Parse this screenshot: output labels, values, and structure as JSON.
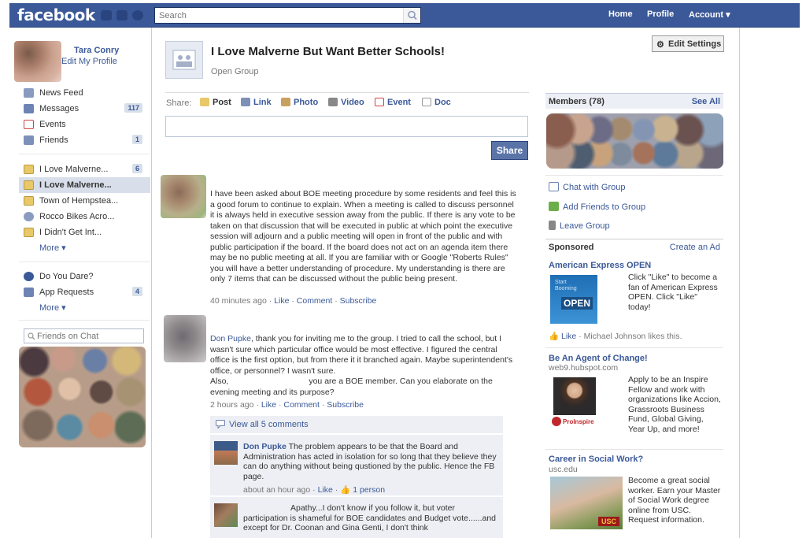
{
  "topbar": {
    "logo": "facebook",
    "search_placeholder": "Search",
    "nav": [
      "Home",
      "Profile",
      "Account"
    ]
  },
  "sidebar": {
    "profile_name": "Tara Conry",
    "edit_profile": "Edit My Profile",
    "items": [
      {
        "label": "News Feed",
        "icon": "news-feed-icon"
      },
      {
        "label": "Messages",
        "count": "117",
        "icon": "messages-icon"
      },
      {
        "label": "Events",
        "icon": "events-icon"
      },
      {
        "label": "Friends",
        "count": "1",
        "icon": "friends-icon"
      }
    ],
    "groups": [
      {
        "label": "I Love Malverne...",
        "count": "6"
      },
      {
        "label": "I Love Malverne..."
      },
      {
        "label": "Town of Hempstea..."
      },
      {
        "label": "Rocco Bikes Acro..."
      },
      {
        "label": "I Didn't Get Int..."
      }
    ],
    "more_label": "More",
    "apps": [
      {
        "label": "Do You Dare?"
      },
      {
        "label": "App Requests",
        "count": "4"
      }
    ],
    "chat_placeholder": "Friends on Chat"
  },
  "group": {
    "title": "I Love Malverne But Want Better Schools!",
    "type": "Open Group",
    "edit_settings": "Edit Settings"
  },
  "composer": {
    "share_label": "Share:",
    "options": [
      "Post",
      "Link",
      "Photo",
      "Video",
      "Event",
      "Doc"
    ],
    "share_button": "Share"
  },
  "posts": [
    {
      "author": "",
      "text": "I have been asked about BOE meeting procedure by some residents and feel this is a good forum to continue to explain. When a meeting is called to discuss personnel it is always held in executive session away from the public. If there is any vote to be taken on that discussion that will be executed in public at which point the executive session will adjourn and a public meeting will open in front of the public and with public participation if the board. If the board does not act on an agenda item there may be no public meeting at all. If you are familiar with or Google \"Roberts Rules\" you will have a better understanding of procedure. My understanding is there are only 7 items that can be discussed without the public being present.",
      "time": "40 minutes ago"
    },
    {
      "mention": "Don Pupke",
      "text": ", thank you for inviting me to the group. I tried to call the school, but I wasn't sure which particular office would be most effective. I figured the central office is the first option, but from there it it branched again. Maybe superintendent's office, or personnel? I wasn't sure.",
      "text2a": "Also,",
      "text2b": "you are a BOE member. Can you elaborate on the evening meeting and its purpose?",
      "time": "2 hours ago"
    }
  ],
  "post_actions": {
    "like": "Like",
    "comment": "Comment",
    "subscribe": "Subscribe",
    "dot": "·"
  },
  "comments": {
    "view_all": "View all 5 comments",
    "items": [
      {
        "author": "Don Pupke",
        "text": "The problem appears to be that the Board and Administration has acted in isolation for so long that they believe they can do anything without being qustioned by the public. Hence the FB page.",
        "time": "about an hour ago",
        "like": "Like",
        "likes": "1 person"
      },
      {
        "author": "",
        "text_line1": "Apathy...I don't know if you follow it, but voter",
        "text_rest": "participation is shameful for BOE candidates and Budget vote......and except for Dr. Coonan and Gina Genti, I don't think"
      }
    ]
  },
  "right": {
    "members_label": "Members (78)",
    "see_all": "See All",
    "actions": [
      "Chat with Group",
      "Add Friends to Group",
      "Leave Group"
    ],
    "sponsored": "Sponsored",
    "create_ad": "Create an Ad",
    "ads": [
      {
        "title": "American Express OPEN",
        "body": "Click \"Like\" to become a fan of American Express OPEN. Click \"Like\" today!",
        "image_caption": "OPEN",
        "image_top": "Start Booming",
        "like": "Like",
        "social": "· Michael Johnson likes this."
      },
      {
        "title": "Be An Agent of Change!",
        "url": "web9.hubspot.com",
        "body": "Apply to be an Inspire Fellow and work with organizations like Accion, Grassroots Business Fund, Global Giving, Year Up, and more!",
        "image_caption": "ProInspire"
      },
      {
        "title": "Career in Social Work?",
        "url": "usc.edu",
        "body": "Become a great social worker. Earn your Master of Social Work degree online from USC. Request information.",
        "image_caption": "USC"
      }
    ]
  },
  "colors": {
    "brand": "#3b5998",
    "brand_dark": "#29447e",
    "count_bg": "#d8dfea",
    "comment_bg": "#edeff4"
  }
}
